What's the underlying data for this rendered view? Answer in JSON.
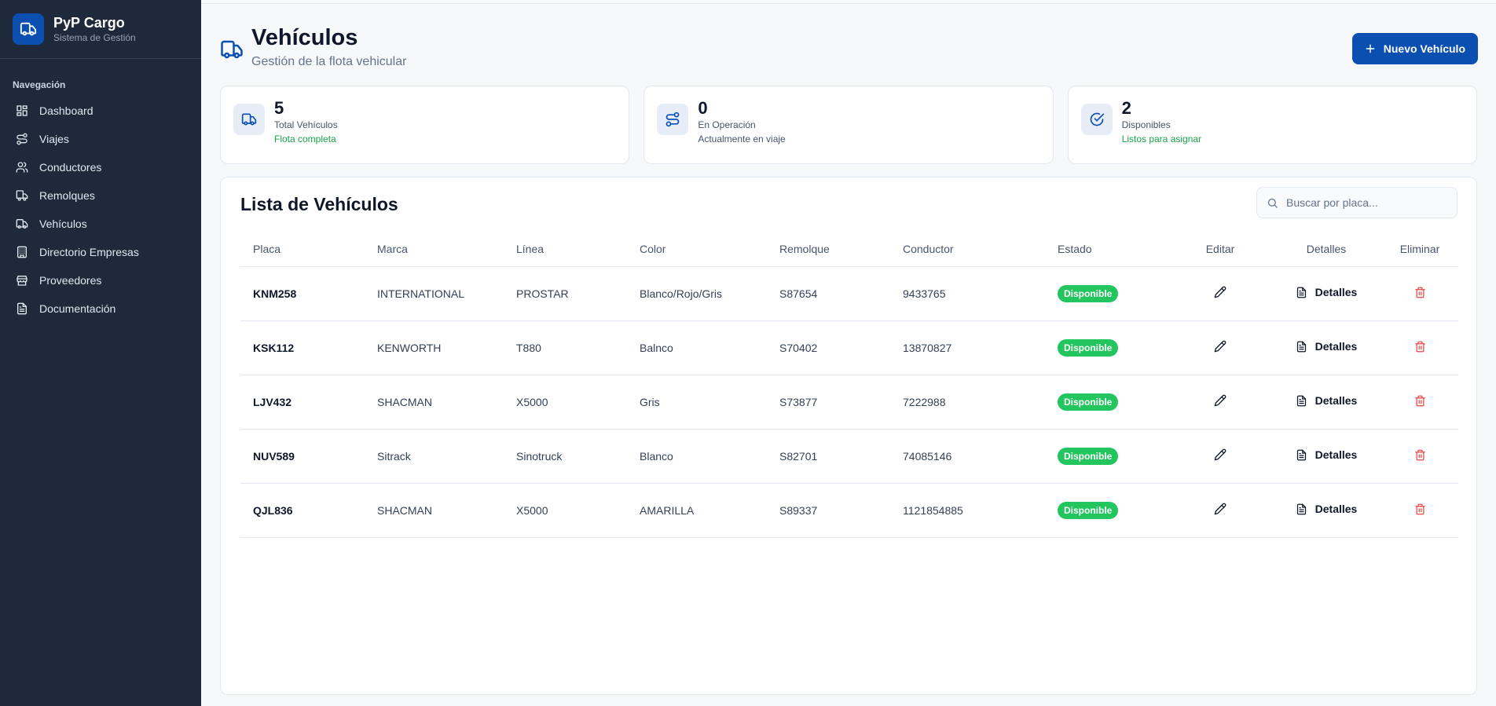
{
  "brand": {
    "title": "PyP Cargo",
    "subtitle": "Sistema de Gestión"
  },
  "sidebar": {
    "section_label": "Navegación",
    "items": [
      {
        "label": "Dashboard",
        "icon": "grid-icon"
      },
      {
        "label": "Viajes",
        "icon": "route-icon"
      },
      {
        "label": "Conductores",
        "icon": "users-icon"
      },
      {
        "label": "Remolques",
        "icon": "trailer-icon"
      },
      {
        "label": "Vehículos",
        "icon": "truck-icon"
      },
      {
        "label": "Directorio Empresas",
        "icon": "building-icon"
      },
      {
        "label": "Proveedores",
        "icon": "store-icon"
      },
      {
        "label": "Documentación",
        "icon": "document-icon"
      }
    ]
  },
  "header": {
    "title": "Vehículos",
    "subtitle": "Gestión de la flota vehicular",
    "new_button": "Nuevo Vehículo"
  },
  "stats": [
    {
      "value": "5",
      "label": "Total Vehículos",
      "note": "Flota completa",
      "note_color": "#16a34a",
      "icon": "truck-icon"
    },
    {
      "value": "0",
      "label": "En Operación",
      "note": "Actualmente en viaje",
      "note_color": "#475569",
      "icon": "route-icon"
    },
    {
      "value": "2",
      "label": "Disponibles",
      "note": "Listos para asignar",
      "note_color": "#16a34a",
      "icon": "check-circle-icon"
    }
  ],
  "list": {
    "title": "Lista de Vehículos",
    "search_placeholder": "Buscar por placa...",
    "columns": [
      "Placa",
      "Marca",
      "Línea",
      "Color",
      "Remolque",
      "Conductor",
      "Estado",
      "Editar",
      "Detalles",
      "Eliminar"
    ],
    "details_label": "Detalles",
    "rows": [
      {
        "placa": "KNM258",
        "marca": "INTERNATIONAL",
        "linea": "PROSTAR",
        "color": "Blanco/Rojo/Gris",
        "remolque": "S87654",
        "conductor": "9433765",
        "estado": "Disponible"
      },
      {
        "placa": "KSK112",
        "marca": "KENWORTH",
        "linea": "T880",
        "color": "Balnco",
        "remolque": "S70402",
        "conductor": "13870827",
        "estado": "Disponible"
      },
      {
        "placa": "LJV432",
        "marca": "SHACMAN",
        "linea": "X5000",
        "color": "Gris",
        "remolque": "S73877",
        "conductor": "7222988",
        "estado": "Disponible"
      },
      {
        "placa": "NUV589",
        "marca": "Sitrack",
        "linea": "Sinotruck",
        "color": "Blanco",
        "remolque": "S82701",
        "conductor": "74085146",
        "estado": "Disponible"
      },
      {
        "placa": "QJL836",
        "marca": "SHACMAN",
        "linea": "X5000",
        "color": "AMARILLA",
        "remolque": "S89337",
        "conductor": "1121854885",
        "estado": "Disponible"
      }
    ]
  },
  "colors": {
    "primary": "#0b50b0",
    "sidebar": "#1e293b",
    "success": "#22c55e",
    "danger": "#ef4444"
  }
}
